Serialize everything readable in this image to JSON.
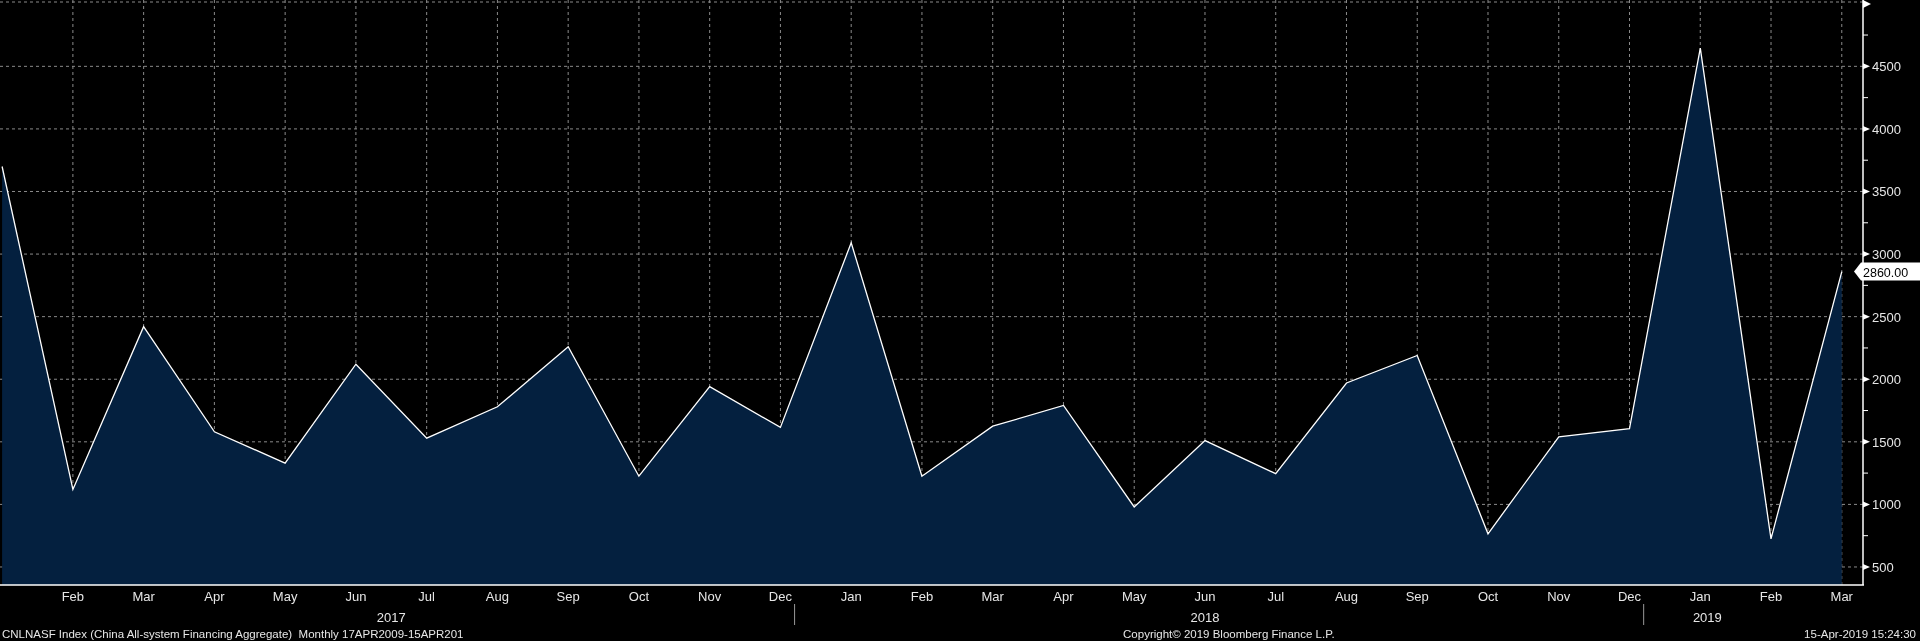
{
  "chart": {
    "last_value_label": "2860.00",
    "chart_data": {
      "type": "area",
      "categories": [
        null,
        "Feb",
        "Mar",
        "Apr",
        "May",
        "Jun",
        "Jul",
        "Aug",
        "Sep",
        "Oct",
        "Nov",
        "Dec",
        "Jan",
        "Feb",
        "Mar",
        "Apr",
        "May",
        "Jun",
        "Jul",
        "Aug",
        "Sep",
        "Oct",
        "Nov",
        "Dec",
        "Jan",
        "Feb",
        "Mar"
      ],
      "series": [
        {
          "color": "#ffffff",
          "values": [
            3700,
            1120,
            2420,
            1580,
            1330,
            2120,
            1530,
            1780,
            2260,
            1225,
            1940,
            1615,
            3090,
            1225,
            1625,
            1790,
            980,
            1510,
            1245,
            1970,
            2190,
            765,
            1540,
            1605,
            4645,
            725,
            2860
          ]
        }
      ],
      "grid": true,
      "ylim": [
        356,
        5030
      ],
      "yticks": [
        500,
        1000,
        1500,
        2000,
        2500,
        3000,
        3500,
        4000,
        4500
      ]
    },
    "year_labels": [
      "2017",
      "2018",
      "2019"
    ]
  },
  "footer": {
    "description": "CNLNASF Index (China All-system Financing Aggregate)  Monthly 17APR2009-15APR201",
    "copyright": "Copyright© 2019 Bloomberg Finance L.P.",
    "timestamp": "15-Apr-2019 15:24:30"
  }
}
